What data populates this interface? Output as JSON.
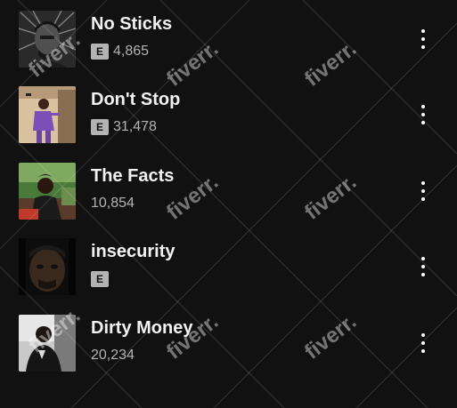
{
  "tracks": [
    {
      "title": "No Sticks",
      "explicit": true,
      "explicit_label": "E",
      "plays": "4,865",
      "art_icon": "album-art-bw-portrait"
    },
    {
      "title": "Don't Stop",
      "explicit": true,
      "explicit_label": "E",
      "plays": "31,478",
      "art_icon": "album-art-purple-performer"
    },
    {
      "title": "The Facts",
      "explicit": false,
      "plays": "10,854",
      "art_icon": "album-art-green-outdoor"
    },
    {
      "title": "insecurity",
      "explicit": true,
      "explicit_label": "E",
      "plays": "",
      "art_icon": "album-art-dark-closeup"
    },
    {
      "title": "Dirty Money",
      "explicit": false,
      "plays": "20,234",
      "art_icon": "album-art-night-portrait"
    }
  ],
  "watermark": "fiverr.",
  "colors": {
    "background": "#111111",
    "title": "#f2f2f2",
    "meta": "#b3b3b3",
    "explicit_badge": "#b3b3b3"
  }
}
